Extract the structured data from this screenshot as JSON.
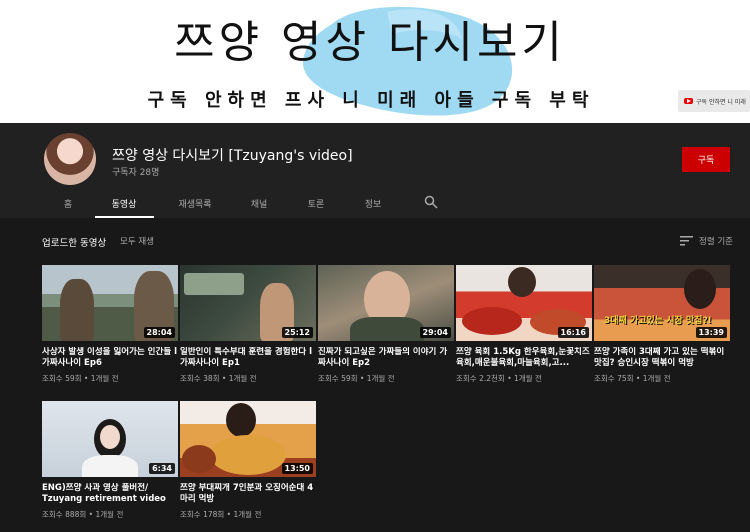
{
  "banner": {
    "title": "쯔양 영상 다시보기",
    "subtitle": "구독 안하면 프사 니 미래 아들 구독 부탁",
    "link_label": "구독 안하면 니 미래",
    "accent_color": "#8fd3f0"
  },
  "channel": {
    "name": "쯔양 영상 다시보기 [Tzuyang's video]",
    "subscribers": "구독자 28명",
    "subscribe_label": "구독",
    "subscribe_color": "#cc0000"
  },
  "tabs": [
    {
      "label": "홈"
    },
    {
      "label": "동영상"
    },
    {
      "label": "재생목록"
    },
    {
      "label": "채널"
    },
    {
      "label": "토론"
    },
    {
      "label": "정보"
    }
  ],
  "section": {
    "title": "업로드한 동영상",
    "play_all": "모두 재생",
    "sort_label": "정렬 기준"
  },
  "videos": [
    {
      "title": "사상자 발생 이성을 잃어가는 인간들 l 가짜사나이 Ep6",
      "meta": "조회수 59회 • 1개월 전",
      "duration": "28:04"
    },
    {
      "title": "일반인이 특수부대 훈련을 경험한다 l 가짜사나이 Ep1",
      "meta": "조회수 38회 • 1개월 전",
      "duration": "25:12"
    },
    {
      "title": "진짜가 되고싶은 가짜들의 이야기 가짜사나이 Ep2",
      "meta": "조회수 59회 • 1개월 전",
      "duration": "29:04"
    },
    {
      "title": "쯔양 육회 1.5Kg 한우육회,눈꽃치즈육회,매운불육회,마늘육회,고...",
      "meta": "조회수 2.2천회 • 1개월 전",
      "duration": "16:16"
    },
    {
      "title": "쯔양 가족이 3대째 가고 있는 떡볶이 맛집? 승인시장 떡볶이 먹방",
      "meta": "조회수 75회 • 1개월 전",
      "duration": "13:39",
      "caption": "3대째 가고있는 시장 맛집?!"
    },
    {
      "title": "ENG)쯔양 사과 영상 풀버전/ Tzuyang retirement video",
      "meta": "조회수 888회 • 1개월 전",
      "duration": "6:34"
    },
    {
      "title": "쯔양 부대찌개 7인분과 오징어순대 4마리 먹방",
      "meta": "조회수 178회 • 1개월 전",
      "duration": "13:50"
    }
  ]
}
